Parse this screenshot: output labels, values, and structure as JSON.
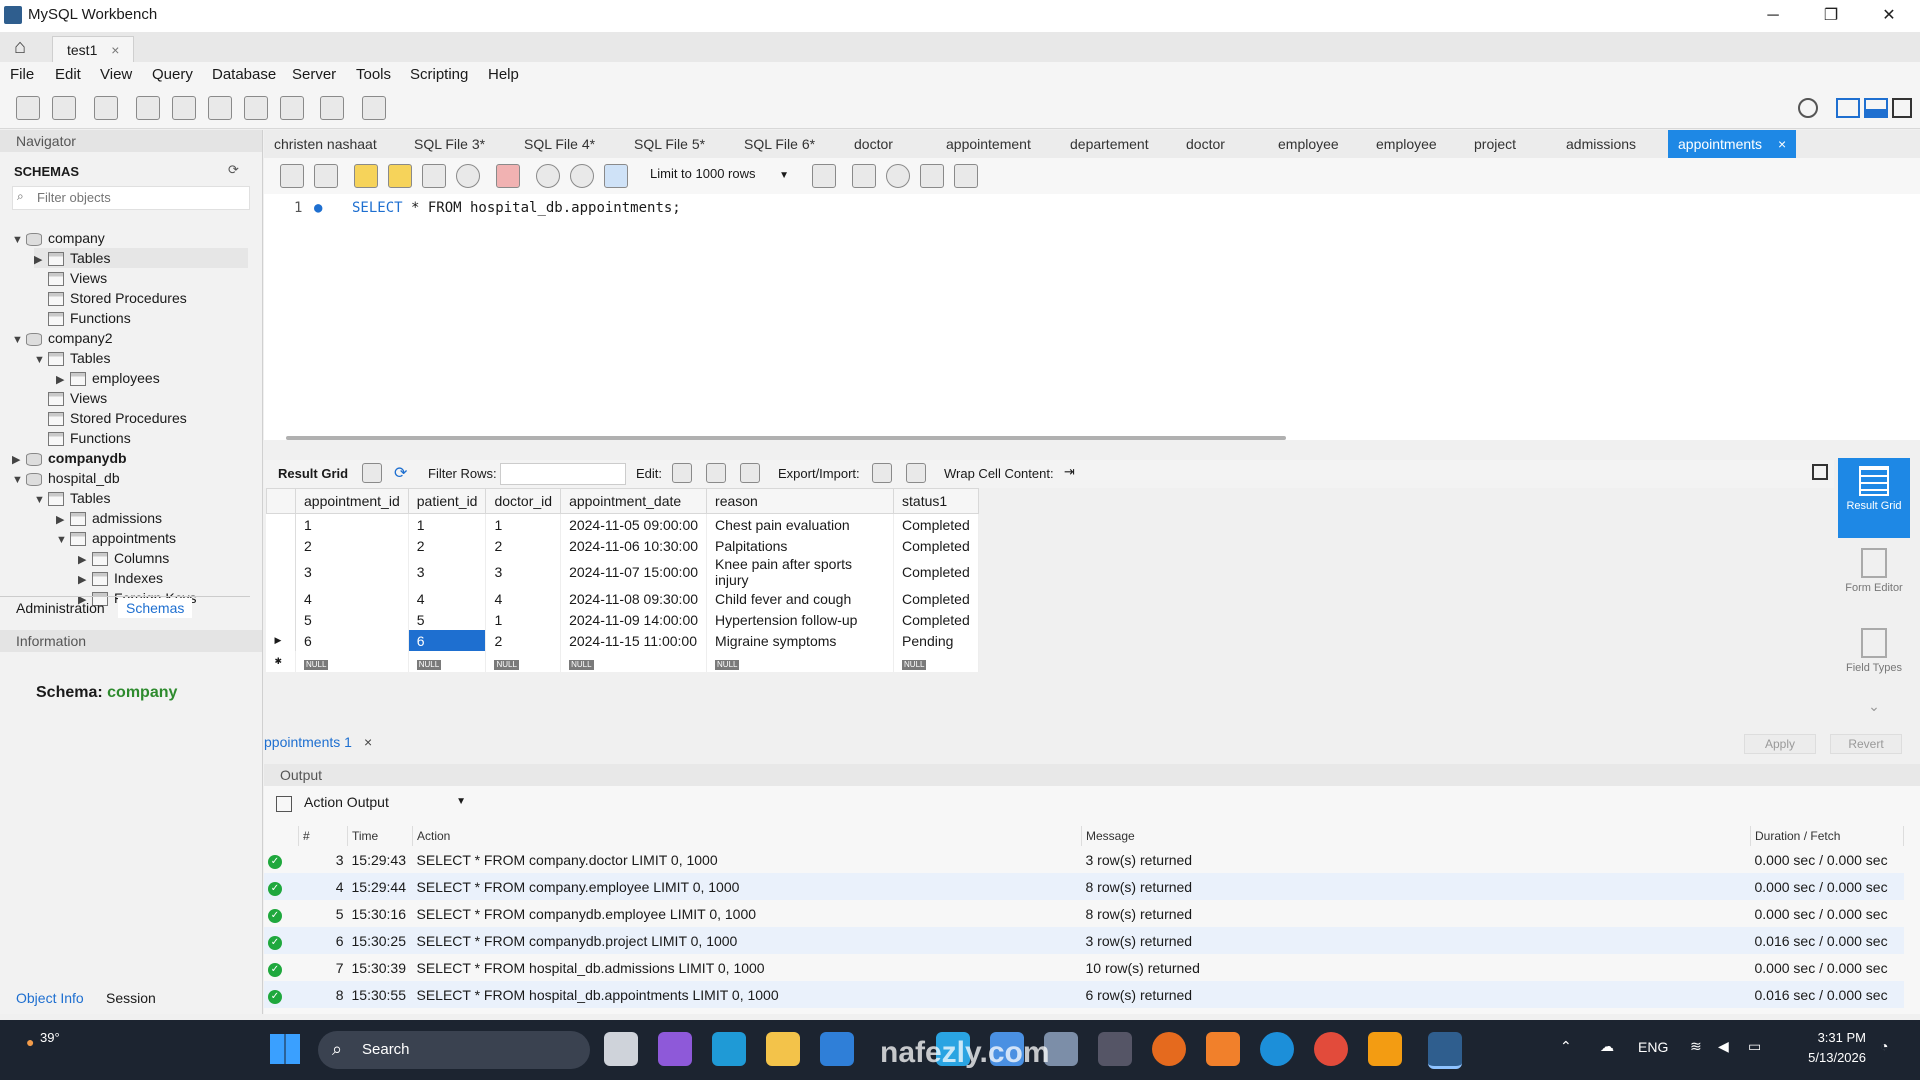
{
  "window": {
    "title": "MySQL Workbench",
    "tab": "test1",
    "minimize": "─",
    "maximize": "❐",
    "close": "✕"
  },
  "menu": [
    "File",
    "Edit",
    "View",
    "Query",
    "Database",
    "Server",
    "Tools",
    "Scripting",
    "Help"
  ],
  "navigator": {
    "header": "Navigator",
    "schemas_label": "SCHEMAS",
    "filter_placeholder": "Filter objects",
    "tree": [
      {
        "label": "company",
        "level": 0,
        "type": "db",
        "expanded": true,
        "bold": false
      },
      {
        "label": "Tables",
        "level": 1,
        "type": "folder",
        "expanded": false
      },
      {
        "label": "Views",
        "level": 1,
        "type": "folder"
      },
      {
        "label": "Stored Procedures",
        "level": 1,
        "type": "folder"
      },
      {
        "label": "Functions",
        "level": 1,
        "type": "folder"
      },
      {
        "label": "company2",
        "level": 0,
        "type": "db",
        "expanded": true
      },
      {
        "label": "Tables",
        "level": 1,
        "type": "folder",
        "expanded": true
      },
      {
        "label": "employees",
        "level": 2,
        "type": "table"
      },
      {
        "label": "Views",
        "level": 1,
        "type": "folder"
      },
      {
        "label": "Stored Procedures",
        "level": 1,
        "type": "folder"
      },
      {
        "label": "Functions",
        "level": 1,
        "type": "folder"
      },
      {
        "label": "companydb",
        "level": 0,
        "type": "db",
        "bold": true
      },
      {
        "label": "hospital_db",
        "level": 0,
        "type": "db",
        "expanded": true
      },
      {
        "label": "Tables",
        "level": 1,
        "type": "folder",
        "expanded": true
      },
      {
        "label": "admissions",
        "level": 2,
        "type": "table"
      },
      {
        "label": "appointments",
        "level": 2,
        "type": "table",
        "expanded": true
      },
      {
        "label": "Columns",
        "level": 3,
        "type": "folder"
      },
      {
        "label": "Indexes",
        "level": 3,
        "type": "folder"
      },
      {
        "label": "Foreign Keys",
        "level": 3,
        "type": "folder"
      }
    ],
    "tab_admin": "Administration",
    "tab_schemas": "Schemas",
    "info_header": "Information",
    "schema_label": "Schema:",
    "schema_value": "company",
    "tab_object_info": "Object Info",
    "tab_session": "Session"
  },
  "editor_tabs": [
    "christen nashaat",
    "SQL File 3*",
    "SQL File 4*",
    "SQL File 5*",
    "SQL File 6*",
    "doctor",
    "appointement",
    "departement",
    "doctor",
    "employee",
    "employee",
    "project",
    "admissions",
    "appointments"
  ],
  "editor": {
    "limit_label": "Limit to 1000 rows",
    "line_no": "1",
    "sql_keyword": "SELECT",
    "sql_rest": " * FROM hospital_db.appointments;"
  },
  "result_toolbar": {
    "result_grid": "Result Grid",
    "filter_rows": "Filter Rows:",
    "edit": "Edit:",
    "export_import": "Export/Import:",
    "wrap": "Wrap Cell Content:"
  },
  "grid": {
    "columns": [
      "appointment_id",
      "patient_id",
      "doctor_id",
      "appointment_date",
      "reason",
      "status1"
    ],
    "rows": [
      [
        "1",
        "1",
        "1",
        "2024-11-05 09:00:00",
        "Chest pain evaluation",
        "Completed"
      ],
      [
        "2",
        "2",
        "2",
        "2024-11-06 10:30:00",
        "Palpitations",
        "Completed"
      ],
      [
        "3",
        "3",
        "3",
        "2024-11-07 15:00:00",
        "Knee pain after sports injury",
        "Completed"
      ],
      [
        "4",
        "4",
        "4",
        "2024-11-08 09:30:00",
        "Child fever and cough",
        "Completed"
      ],
      [
        "5",
        "5",
        "1",
        "2024-11-09 14:00:00",
        "Hypertension follow-up",
        "Completed"
      ],
      [
        "6",
        "6",
        "2",
        "2024-11-15 11:00:00",
        "Migraine symptoms",
        "Pending"
      ]
    ],
    "null_label": "NULL"
  },
  "right_rail": {
    "result_grid": "Result Grid",
    "form_editor": "Form Editor",
    "field_types": "Field Types"
  },
  "result_tab": "ppointments 1",
  "apply": "Apply",
  "revert": "Revert",
  "output": {
    "header": "Output",
    "selector": "Action Output",
    "columns": [
      "#",
      "Time",
      "Action",
      "Message",
      "Duration / Fetch"
    ],
    "rows": [
      [
        "3",
        "15:29:43",
        "SELECT * FROM company.doctor LIMIT 0, 1000",
        "3 row(s) returned",
        "0.000 sec / 0.000 sec"
      ],
      [
        "4",
        "15:29:44",
        "SELECT * FROM company.employee LIMIT 0, 1000",
        "8 row(s) returned",
        "0.000 sec / 0.000 sec"
      ],
      [
        "5",
        "15:30:16",
        "SELECT * FROM companydb.employee LIMIT 0, 1000",
        "8 row(s) returned",
        "0.000 sec / 0.000 sec"
      ],
      [
        "6",
        "15:30:25",
        "SELECT * FROM companydb.project LIMIT 0, 1000",
        "3 row(s) returned",
        "0.016 sec / 0.000 sec"
      ],
      [
        "7",
        "15:30:39",
        "SELECT * FROM hospital_db.admissions LIMIT 0, 1000",
        "10 row(s) returned",
        "0.000 sec / 0.000 sec"
      ],
      [
        "8",
        "15:30:55",
        "SELECT * FROM hospital_db.appointments LIMIT 0, 1000",
        "6 row(s) returned",
        "0.016 sec / 0.000 sec"
      ]
    ]
  },
  "taskbar": {
    "weather": "39°",
    "search": "Search",
    "lang": "ENG",
    "time": "3:31 PM",
    "date": "5/13/2026",
    "watermark": "nafezly.com"
  }
}
